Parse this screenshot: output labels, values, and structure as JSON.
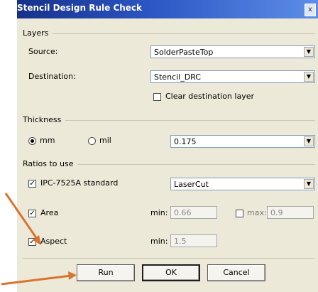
{
  "window": {
    "title": "Stencil Design Rule Check",
    "close_glyph": "x"
  },
  "layers": {
    "section_label": "Layers",
    "source_label": "Source:",
    "source_value": "SolderPasteTop",
    "destination_label": "Destination:",
    "destination_value": "Stencil_DRC",
    "clear_label": "Clear destination layer",
    "clear_checked": false
  },
  "thickness": {
    "section_label": "Thickness",
    "mm_label": "mm",
    "mil_label": "mil",
    "selected_unit": "mm",
    "value": "0.175"
  },
  "ratios": {
    "section_label": "Ratios to use",
    "ipc_label": "IPC-7525A standard",
    "ipc_checked": true,
    "ipc_value": "LaserCut",
    "area_label": "Area",
    "area_checked": true,
    "area_min_label": "min:",
    "area_min_value": "0.66",
    "area_max_label": "max:",
    "area_max_checked": false,
    "area_max_value": "0.9",
    "aspect_label": "Aspect",
    "aspect_checked": true,
    "aspect_min_label": "min:",
    "aspect_min_value": "1.5"
  },
  "buttons": {
    "run": "Run",
    "ok": "OK",
    "cancel": "Cancel"
  },
  "colors": {
    "titlebar": "#2c57c4",
    "dialog_bg": "#ece9d8",
    "arrow": "#d9742f"
  },
  "icons": {
    "dropdown": "chevron-down-icon",
    "checkmark": "check-icon"
  }
}
